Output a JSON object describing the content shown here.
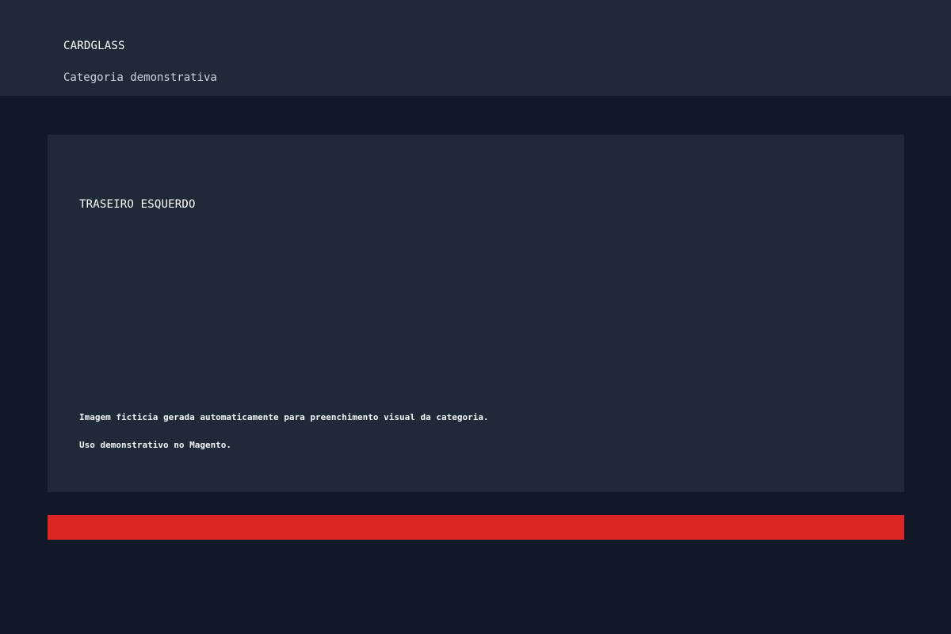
{
  "header": {
    "brand": "CARDGLASS",
    "subtitle": "Categoria demonstrativa"
  },
  "card": {
    "title": "TRASEIRO ESQUERDO",
    "notes": [
      "Imagem ficticia gerada automaticamente para preenchimento visual da categoria.",
      "Uso demonstrativo no Magento."
    ]
  },
  "colors": {
    "background": "#111827",
    "surface": "#1f2937",
    "accent": "#dc2626"
  }
}
